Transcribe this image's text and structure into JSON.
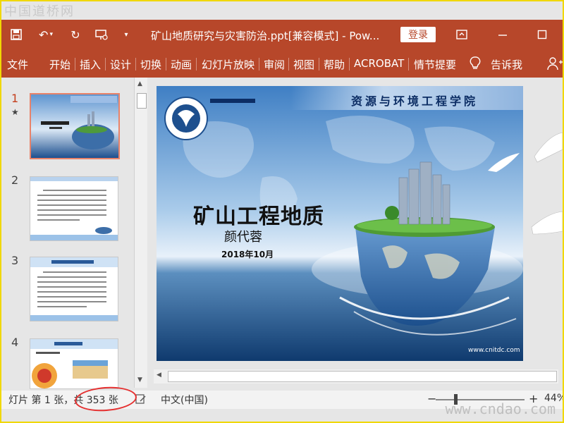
{
  "watermarks": {
    "top": "中国道桥网",
    "bottom": "www.cndao.com"
  },
  "titlebar": {
    "title": "矿山地质研究与灾害防治.ppt[兼容模式]  -  Pow...",
    "login_label": "登录"
  },
  "ribbon": {
    "tabs": [
      "文件",
      "开始",
      "插入",
      "设计",
      "切换",
      "动画",
      "幻灯片放映",
      "审阅",
      "视图",
      "帮助",
      "ACROBAT",
      "情节提要"
    ],
    "tell_me": "告诉我"
  },
  "thumbnails": [
    {
      "number": "1",
      "active": true,
      "starred": true
    },
    {
      "number": "2",
      "active": false,
      "starred": false
    },
    {
      "number": "3",
      "active": false,
      "starred": false
    },
    {
      "number": "4",
      "active": false,
      "starred": false
    }
  ],
  "slide": {
    "title": "矿山工程地质",
    "author": "颜代蓉",
    "date": "2018年10月",
    "school": "资源与环境工程学院",
    "url": "www.cnitdc.com"
  },
  "statusbar": {
    "slide_info": "灯片 第 1 张，共 353 张",
    "language": "中文(中国)",
    "zoom": "44%",
    "zoom_value": 44
  },
  "colors": {
    "accent": "#b7472a",
    "highlight": "#e53030"
  }
}
